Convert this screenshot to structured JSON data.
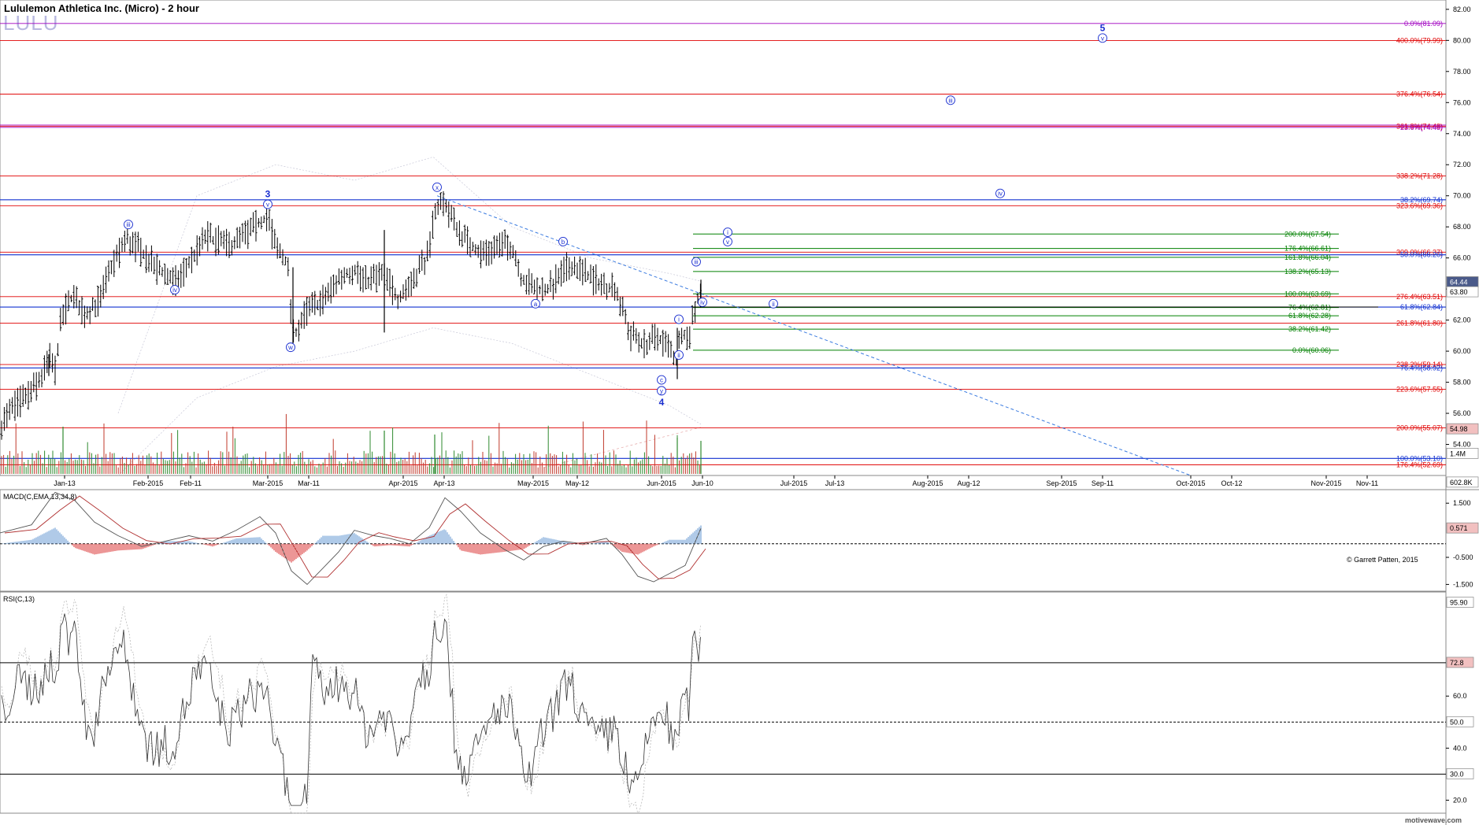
{
  "header": {
    "title": "Lululemon Athletica Inc. (Micro) - 2 hour",
    "symbol": "LULU"
  },
  "copyright": "© Garrett Patten, 2015",
  "watermark": "motivewave.com",
  "colors": {
    "fib_red": "#e00000",
    "fib_blue": "#1030d0",
    "fib_green": "#008000",
    "fib_purple": "#a000c0",
    "wave_blue": "#1a2fd0",
    "trend_dash": "#3a7be0",
    "price_bar": "#000000",
    "volume": "#c0392b",
    "macd_signal": "#b03030",
    "hist_pos": "#7aa7d8",
    "hist_neg": "#e05050"
  },
  "chart_data": [
    {
      "id": "price",
      "type": "ohlc",
      "ylim": [
        52,
        82.6
      ],
      "yticks": [
        "54.00",
        "56.00",
        "58.00",
        "60.00",
        "62.00",
        "64.00",
        "66.00",
        "68.00",
        "70.00",
        "72.00",
        "74.00",
        "76.00",
        "78.00",
        "80.00",
        "82.00"
      ],
      "price_labels": [
        {
          "text": "64.44",
          "value": 64.44,
          "style": "dark"
        },
        {
          "text": "63.80",
          "value": 63.8,
          "style": "light"
        },
        {
          "text": "54.98",
          "value": 54.98,
          "style": "red"
        },
        {
          "text": "1.4M",
          "value": 53.4,
          "style": "light"
        },
        {
          "text": "602.8K",
          "value": 51.55,
          "style": "light"
        }
      ],
      "x_labels": [
        "Jan-13",
        "Feb-2015",
        "Feb-11",
        "Mar-2015",
        "Mar-11",
        "Apr-2015",
        "Apr-13",
        "May-2015",
        "May-12",
        "Jun-2015",
        "Jun-10",
        "Jul-2015",
        "Jul-13",
        "Aug-2015",
        "Aug-12",
        "Sep-2015",
        "Sep-11",
        "Oct-2015",
        "Oct-12",
        "Nov-2015",
        "Nov-11"
      ],
      "fib_lines": [
        {
          "label": "0.0%(81.09)",
          "value": 81.09,
          "color": "purple"
        },
        {
          "label": "400.0%(79.99)",
          "value": 79.99,
          "color": "red"
        },
        {
          "label": "376.4%(76.54)",
          "value": 76.54,
          "color": "red"
        },
        {
          "label": "361.8%(74.48)",
          "value": 74.48,
          "color": "red"
        },
        {
          "label": "23.6%(74.48)",
          "value": 74.4,
          "color": "purple"
        },
        {
          "label": "338.2%(71.28)",
          "value": 71.28,
          "color": "red"
        },
        {
          "label": "38.2%(69.74)",
          "value": 69.74,
          "color": "blue"
        },
        {
          "label": "323.6%(69.36)",
          "value": 69.36,
          "color": "red"
        },
        {
          "label": "309.0%(66.37)",
          "value": 66.37,
          "color": "red"
        },
        {
          "label": "50.0%(66.20)",
          "value": 66.2,
          "color": "blue"
        },
        {
          "label": "276.4%(63.51)",
          "value": 63.51,
          "color": "red"
        },
        {
          "label": "61.8%(62.84)",
          "value": 62.84,
          "color": "blue"
        },
        {
          "label": "261.8%(61.80)",
          "value": 61.8,
          "color": "red"
        },
        {
          "label": "238.2%(59.14)",
          "value": 59.14,
          "color": "red"
        },
        {
          "label": "76.4%(58.92)",
          "value": 58.92,
          "color": "blue"
        },
        {
          "label": "223.6%(57.55)",
          "value": 57.55,
          "color": "red"
        },
        {
          "label": "200.0%(55.07)",
          "value": 55.07,
          "color": "red"
        },
        {
          "label": "100.0%(53.10)",
          "value": 53.1,
          "color": "blue"
        },
        {
          "label": "176.4%(52.69)",
          "value": 52.69,
          "color": "red"
        }
      ],
      "green_fib_lines": [
        {
          "label": "200.0%(67.54)",
          "value": 67.54
        },
        {
          "label": "176.4%(66.61)",
          "value": 66.61
        },
        {
          "label": "161.8%(66.04)",
          "value": 66.04
        },
        {
          "label": "138.2%(65.13)",
          "value": 65.13
        },
        {
          "label": "100.0%(63.69)",
          "value": 63.69
        },
        {
          "label": "76.4%(62.81)",
          "value": 62.81
        },
        {
          "label": "61.8%(62.28)",
          "value": 62.28
        },
        {
          "label": "38.2%(61.42)",
          "value": 61.42
        },
        {
          "label": "0.0%(60.06)",
          "value": 60.06
        }
      ],
      "wave_labels": [
        {
          "text": "iii",
          "circled": true,
          "x": "Jan-20",
          "value": 68.0
        },
        {
          "text": "iv",
          "circled": true,
          "x": "Feb-07",
          "value": 63.8
        },
        {
          "text": "3",
          "circled": false,
          "bold": true,
          "x": "Mar-2015",
          "value": 69.9
        },
        {
          "text": "v",
          "circled": true,
          "x": "Mar-2015",
          "value": 69.3
        },
        {
          "text": "w",
          "circled": true,
          "x": "Mar-07",
          "value": 60.1
        },
        {
          "text": "x",
          "circled": true,
          "x": "Apr-10",
          "value": 70.4
        },
        {
          "text": "b",
          "circled": true,
          "x": "May-06",
          "value": 66.9
        },
        {
          "text": "a",
          "circled": true,
          "x": "Apr-30",
          "value": 62.9
        },
        {
          "text": "c",
          "circled": true,
          "x": "Jun-2015",
          "value": 58.0
        },
        {
          "text": "y",
          "circled": true,
          "x": "Jun-2015",
          "value": 57.3
        },
        {
          "text": "4",
          "circled": false,
          "bold": true,
          "x": "Jun-2015",
          "value": 56.5
        },
        {
          "text": "i",
          "circled": true,
          "x": "Jun-04",
          "value": 61.9
        },
        {
          "text": "ii",
          "circled": true,
          "x": "Jun-04",
          "value": 59.6
        },
        {
          "text": "iii",
          "circled": true,
          "x": "Jun-08",
          "value": 65.6
        },
        {
          "text": "iv",
          "circled": true,
          "x": "Jun-10",
          "value": 63.0
        },
        {
          "text": "v",
          "circled": true,
          "x": "Jun-12",
          "value": 66.9
        },
        {
          "text": "i",
          "circled": true,
          "x": "Jun-12",
          "value": 67.5
        },
        {
          "text": "ii",
          "circled": true,
          "x": "Jun-24",
          "value": 62.9
        },
        {
          "text": "iii",
          "circled": true,
          "x": "Aug-07",
          "value": 76.0
        },
        {
          "text": "iv",
          "circled": true,
          "x": "Aug-15",
          "value": 70.0
        },
        {
          "text": "5",
          "circled": false,
          "bold": true,
          "x": "Sep-11",
          "value": 80.6
        },
        {
          "text": "v",
          "circled": true,
          "x": "Sep-11",
          "value": 80.0
        }
      ],
      "trend_line": {
        "from": {
          "x": "Apr-10",
          "value": 70.0
        },
        "to": {
          "x": "Oct-2015",
          "value": 52.0
        }
      }
    },
    {
      "id": "volume",
      "type": "bar",
      "label_values": [
        "1.4M",
        "602.8K"
      ]
    },
    {
      "id": "macd",
      "type": "line",
      "title": "MACD(C,EMA,13,34,8)",
      "ylim": [
        -1.75,
        2.0
      ],
      "yticks": [
        "1.500",
        "-0.500",
        "-1.500"
      ],
      "current_label": "0.571"
    },
    {
      "id": "rsi",
      "type": "line",
      "title": "RSI(C,13)",
      "ylim": [
        15,
        100
      ],
      "yticks": [
        "60.0",
        "40.0",
        "20.0"
      ],
      "labels": [
        {
          "text": "95.90",
          "style": "light"
        },
        {
          "text": "72.8",
          "style": "red"
        },
        {
          "text": "50.0",
          "style": "plain"
        },
        {
          "text": "30.0",
          "style": "plain"
        }
      ]
    }
  ]
}
